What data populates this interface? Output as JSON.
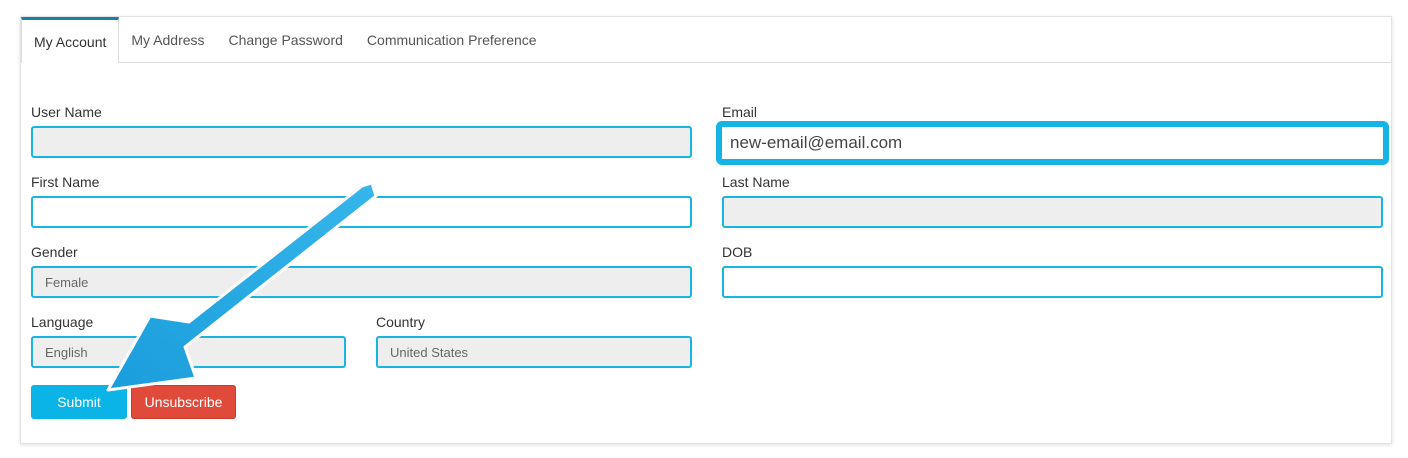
{
  "tabs": [
    {
      "label": "My Account",
      "active": true
    },
    {
      "label": "My Address"
    },
    {
      "label": "Change Password"
    },
    {
      "label": "Communication Preference"
    }
  ],
  "form": {
    "user_name": {
      "label": "User Name",
      "value": ""
    },
    "email": {
      "label": "Email",
      "value": "new-email@email.com"
    },
    "first_name": {
      "label": "First Name",
      "value": ""
    },
    "last_name": {
      "label": "Last Name",
      "value": ""
    },
    "gender": {
      "label": "Gender",
      "value": "Female"
    },
    "dob": {
      "label": "DOB",
      "value": ""
    },
    "language": {
      "label": "Language",
      "value": "English"
    },
    "country": {
      "label": "Country",
      "value": "United States"
    }
  },
  "buttons": {
    "submit": "Submit",
    "unsubscribe": "Unsubscribe"
  },
  "annotation": {
    "icon": "arrow-icon",
    "color": "#1fa3e0"
  }
}
